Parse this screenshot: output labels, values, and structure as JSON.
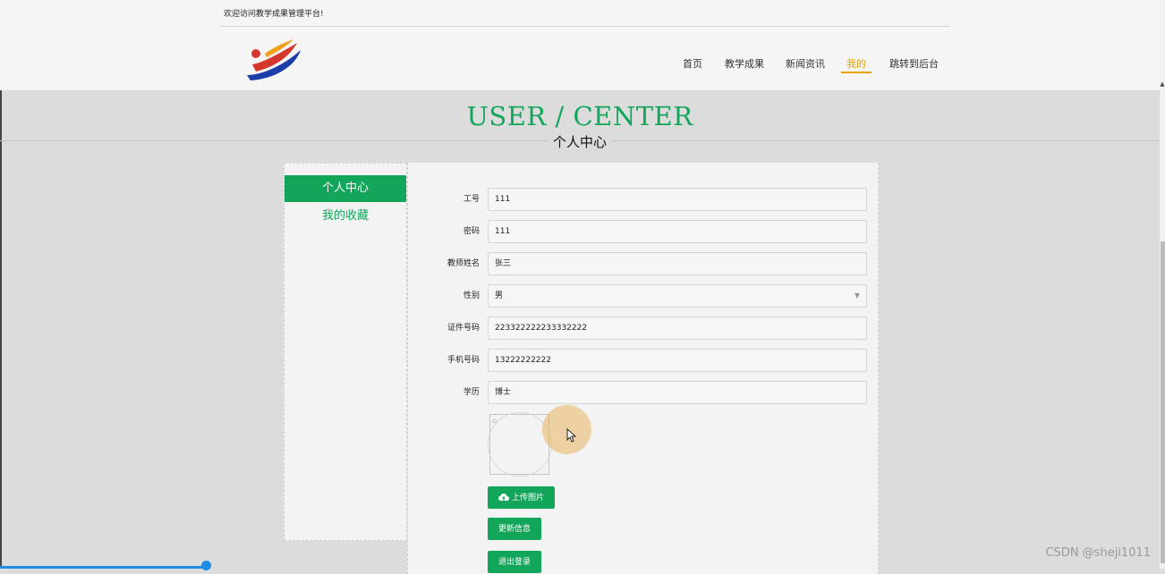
{
  "header": {
    "welcome": "欢迎访问教学成果管理平台!",
    "nav": [
      {
        "label": "首页",
        "active": false
      },
      {
        "label": "教学成果",
        "active": false
      },
      {
        "label": "新闻资讯",
        "active": false
      },
      {
        "label": "我的",
        "active": true
      },
      {
        "label": "跳转到后台",
        "active": false
      }
    ]
  },
  "title": {
    "en": "USER / CENTER",
    "cn": "个人中心"
  },
  "sidebar": {
    "items": [
      {
        "label": "个人中心",
        "active": true
      },
      {
        "label": "我的收藏",
        "active": false
      }
    ]
  },
  "form": {
    "fields": [
      {
        "label": "工号",
        "value": "111"
      },
      {
        "label": "密码",
        "value": "111"
      },
      {
        "label": "教师姓名",
        "value": "张三"
      },
      {
        "label": "性别",
        "value": "男"
      },
      {
        "label": "证件号码",
        "value": "223322222233332222"
      },
      {
        "label": "手机号码",
        "value": "13222222222"
      },
      {
        "label": "学历",
        "value": "博士"
      }
    ]
  },
  "buttons": {
    "upload": "上传图片",
    "update": "更新信息",
    "logout": "退出登录"
  },
  "watermark": "CSDN @sheji1011",
  "colors": {
    "primary": "#12a65a",
    "nav_active": "#e6a100"
  },
  "icons": {
    "upload": "cloud-upload-icon",
    "select": "caret-down-icon",
    "cursor": "mouse-pointer-icon"
  }
}
